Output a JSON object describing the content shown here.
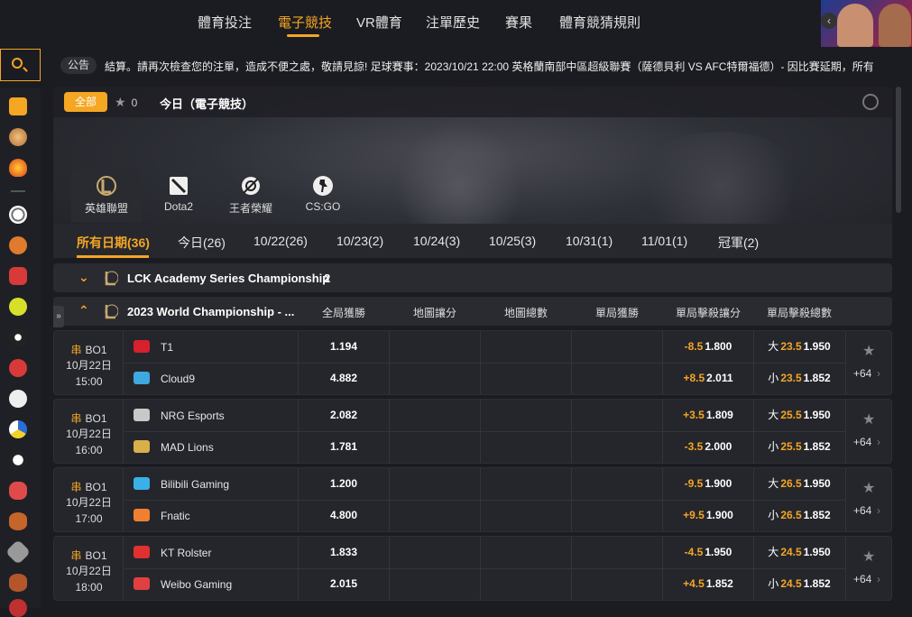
{
  "nav": {
    "items": [
      "體育投注",
      "電子競技",
      "VR體育",
      "注單歷史",
      "賽果",
      "體育競猜規則"
    ],
    "active_index": 1
  },
  "notice": {
    "tag": "公告",
    "text": "結算。請再次檢查您的注單，造成不便之處，敬請見諒!    足球賽事：2023/10/21 22:00 英格蘭南部中區超級聯賽（薩德貝利 VS AFC特爾福德）- 因比賽延期，所有"
  },
  "filter": {
    "all_label": "全部",
    "fav_count": "0",
    "title": "今日（電子競技）"
  },
  "games": [
    {
      "label": "英雄聯盟",
      "icon": "lol-icon",
      "active": true
    },
    {
      "label": "Dota2",
      "icon": "dota2-icon",
      "active": false
    },
    {
      "label": "王者榮耀",
      "icon": "honor-of-kings-icon",
      "active": false
    },
    {
      "label": "CS:GO",
      "icon": "csgo-icon",
      "active": false
    }
  ],
  "dates": [
    "所有日期(36)",
    "今日(26)",
    "10/22(26)",
    "10/23(2)",
    "10/24(3)",
    "10/25(3)",
    "10/31(1)",
    "11/01(1)",
    "冠軍(2)"
  ],
  "leagues": [
    {
      "name": "LCK Academy Series Championship",
      "count": "2",
      "collapsed": true
    },
    {
      "name": "2023 World Championship - ...",
      "count": "",
      "collapsed": false
    }
  ],
  "columns": [
    "全局獲勝",
    "地圖讓分",
    "地圖總數",
    "單局獲勝",
    "單局擊殺讓分",
    "單局擊殺總數"
  ],
  "matches": [
    {
      "bo": "BO1",
      "date": "10月22日",
      "time": "15:00",
      "home": {
        "name": "T1",
        "win": "1.194",
        "hcp": "-8.5",
        "hcp_odds": "1.800",
        "ou": "大",
        "ou_line": "23.5",
        "ou_odds": "1.950"
      },
      "away": {
        "name": "Cloud9",
        "win": "4.882",
        "hcp": "+8.5",
        "hcp_odds": "2.011",
        "ou": "小",
        "ou_line": "23.5",
        "ou_odds": "1.852"
      },
      "more": "+64"
    },
    {
      "bo": "BO1",
      "date": "10月22日",
      "time": "16:00",
      "home": {
        "name": "NRG Esports",
        "win": "2.082",
        "hcp": "+3.5",
        "hcp_odds": "1.809",
        "ou": "大",
        "ou_line": "25.5",
        "ou_odds": "1.950"
      },
      "away": {
        "name": "MAD Lions",
        "win": "1.781",
        "hcp": "-3.5",
        "hcp_odds": "2.000",
        "ou": "小",
        "ou_line": "25.5",
        "ou_odds": "1.852"
      },
      "more": "+64"
    },
    {
      "bo": "BO1",
      "date": "10月22日",
      "time": "17:00",
      "home": {
        "name": "Bilibili Gaming",
        "win": "1.200",
        "hcp": "-9.5",
        "hcp_odds": "1.900",
        "ou": "大",
        "ou_line": "26.5",
        "ou_odds": "1.950"
      },
      "away": {
        "name": "Fnatic",
        "win": "4.800",
        "hcp": "+9.5",
        "hcp_odds": "1.900",
        "ou": "小",
        "ou_line": "26.5",
        "ou_odds": "1.852"
      },
      "more": "+64"
    },
    {
      "bo": "BO1",
      "date": "10月22日",
      "time": "18:00",
      "home": {
        "name": "KT Rolster",
        "win": "1.833",
        "hcp": "-4.5",
        "hcp_odds": "1.950",
        "ou": "大",
        "ou_line": "24.5",
        "ou_odds": "1.950"
      },
      "away": {
        "name": "Weibo Gaming",
        "win": "2.015",
        "hcp": "+4.5",
        "hcp_odds": "1.852",
        "ou": "小",
        "ou_line": "24.5",
        "ou_odds": "1.852"
      },
      "more": "+64"
    }
  ],
  "labels": {
    "chuan": "串"
  },
  "colors": {
    "accent": "#f5a623",
    "bg": "#1b1c21",
    "panel": "#25262c"
  }
}
